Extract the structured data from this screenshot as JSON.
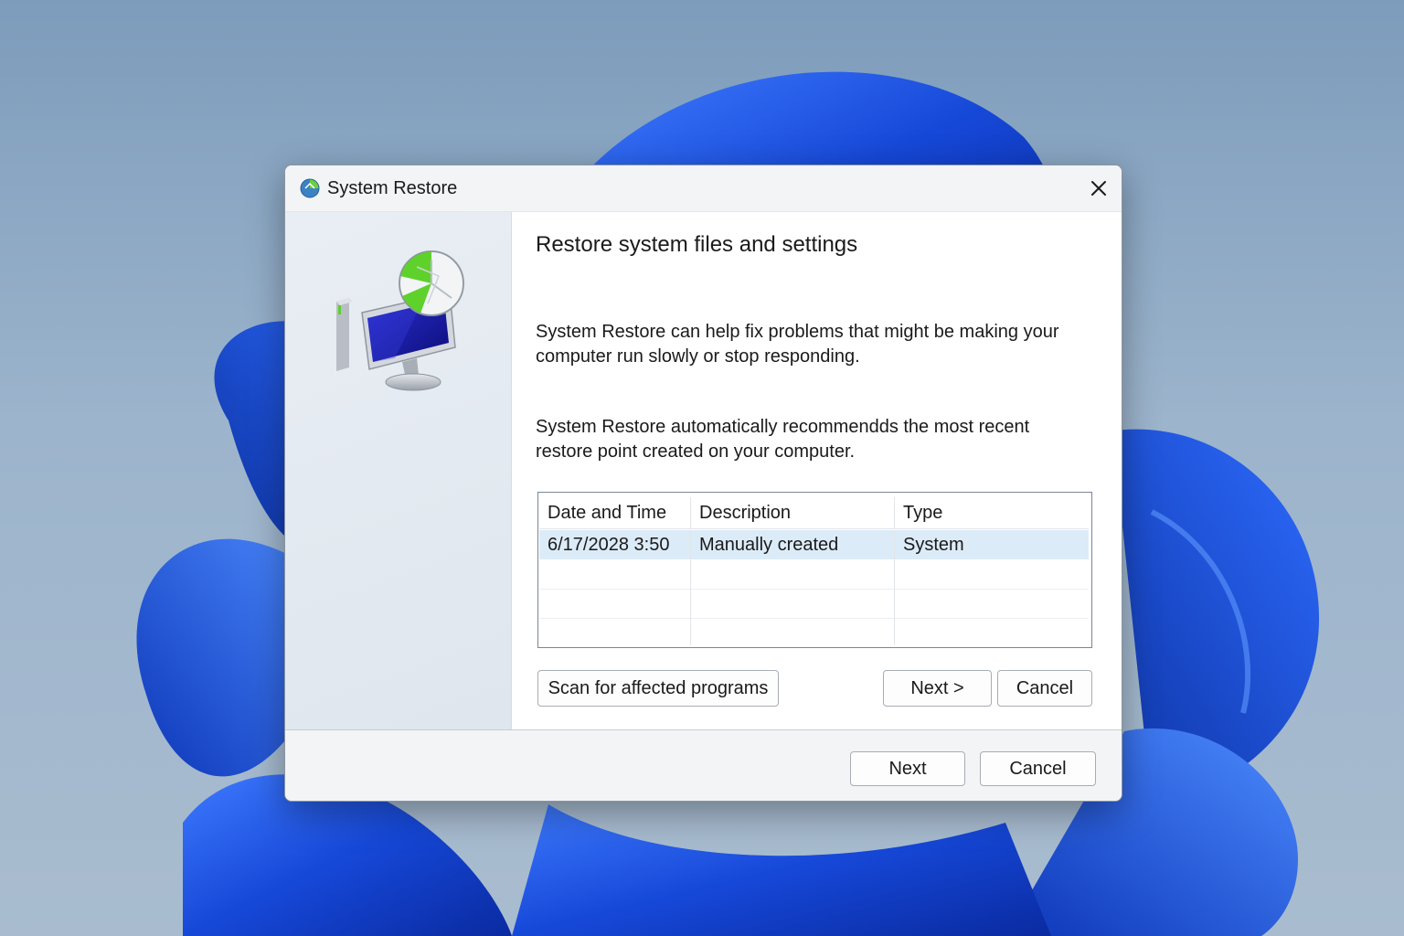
{
  "window": {
    "title": "System Restore",
    "app_icon": "system-restore-icon",
    "close_icon": "close-icon"
  },
  "content": {
    "heading": "Restore system files and settings",
    "paragraph1": "System Restore can help fix problems that might be making your computer run slowly or stop responding.",
    "paragraph2": "System Restore automatically recommendds the most recent restore point created on your computer."
  },
  "table": {
    "columns": [
      "Date and Time",
      "Description",
      "Type"
    ],
    "rows": [
      [
        "6/17/2028 3:50",
        "Manually created",
        "System"
      ]
    ],
    "selected_row": 0
  },
  "buttons": {
    "scan": "Scan for affected programs",
    "next_inner": "Next >",
    "cancel_inner": "Cancel",
    "next_footer": "Next",
    "cancel_footer": "Cancel"
  },
  "colors": {
    "selection": "#dcebf8",
    "wallpaper_blue": "#1a4fd6",
    "monitor_screen": "#1c1fa8",
    "restore_green": "#5fd12b"
  }
}
